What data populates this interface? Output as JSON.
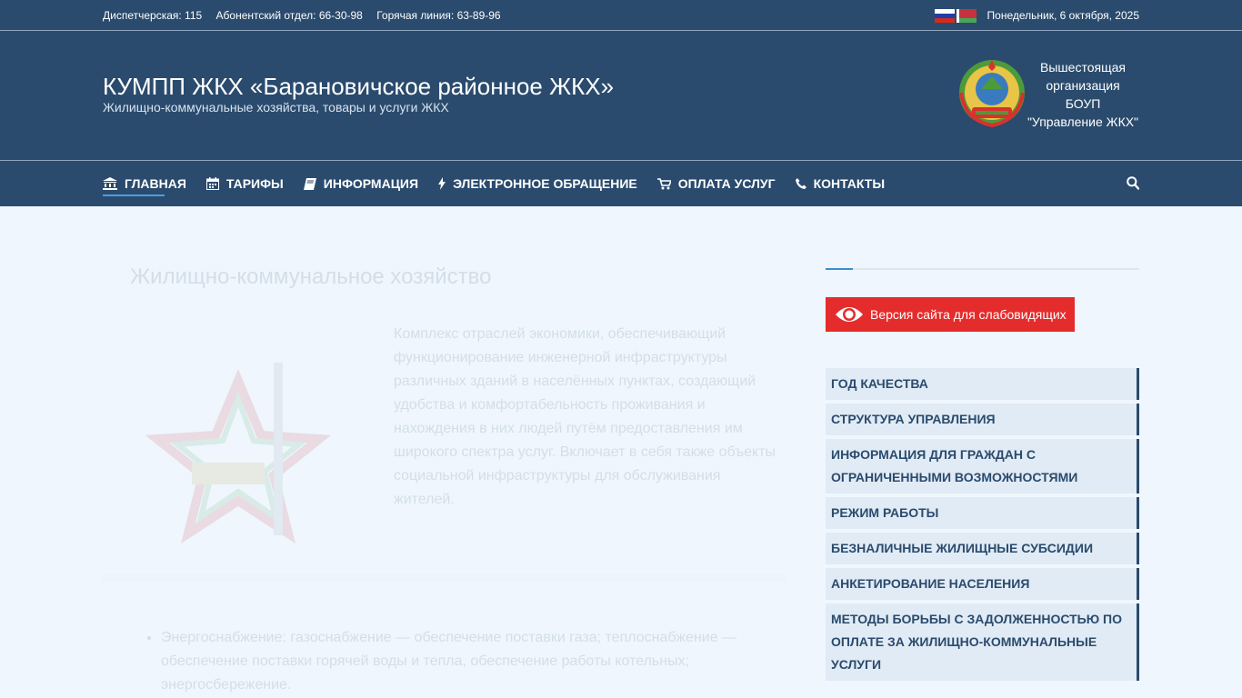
{
  "topbar": {
    "dispatch": "Диспетчерская: 115",
    "subscriber": "Абонентский отдел: 66-30-98",
    "hotline": "Горячая линия: 63-89-96",
    "date": "Понедельник, 6 октября, 2025"
  },
  "header": {
    "title": "КУМПП ЖКХ «Барановичское районное ЖКХ»",
    "subtitle": "Жилищно-коммунальные хозяйства, товары и услуги ЖКХ",
    "superior_line1": "Вышестоящая",
    "superior_line2": "организация",
    "superior_line3": "БОУП",
    "superior_line4": "\"Управление ЖКХ\""
  },
  "nav": {
    "items": [
      {
        "label": "ГЛАВНАЯ",
        "icon": "bank-icon"
      },
      {
        "label": "ТАРИФЫ",
        "icon": "calendar-icon"
      },
      {
        "label": "ИНФОРМАЦИЯ",
        "icon": "book-icon"
      },
      {
        "label": "ЭЛЕКТРОННОЕ ОБРАЩЕНИЕ",
        "icon": "bolt-icon"
      },
      {
        "label": "ОПЛАТА УСЛУГ",
        "icon": "cart-icon"
      },
      {
        "label": "КОНТАКТЫ",
        "icon": "phone-icon"
      }
    ]
  },
  "article": {
    "title": "Жилищно-коммунальное хозяйство",
    "text": "Комплекс отраслей экономики, обеспечивающий функционирование инженерной инфраструктуры различных зданий в населённых пунктах, создающий удобства и комфортабельность проживания и нахождения в них людей путём предоставления им широкого спектра услуг. Включает в себя также объекты социальной инфраструктуры для обслуживания жителей.",
    "list": [
      "Энергоснабжение: газоснабжение — обеспечение поставки газа; теплоснабжение — обеспечение поставки горячей воды и тепла, обеспечение работы котельных; энергосбережение."
    ]
  },
  "sidebar": {
    "impaired_label": "Версия сайта для слабовидящих",
    "menu": [
      "ГОД КАЧЕСТВА",
      "СТРУКТУРА УПРАВЛЕНИЯ",
      "ИНФОРМАЦИЯ ДЛЯ ГРАЖДАН С ОГРАНИЧЕННЫМИ ВОЗМОЖНОСТЯМИ",
      "РЕЖИМ РАБОТЫ",
      "БЕЗНАЛИЧНЫЕ ЖИЛИЩНЫЕ СУБСИДИИ",
      "АНКЕТИРОВАНИЕ НАСЕЛЕНИЯ",
      "МЕТОДЫ БОРЬБЫ С ЗАДОЛЖЕННОСТЬЮ ПО ОПЛАТЕ ЗА ЖИЛИЩНО-КОММУНАЛЬНЫЕ УСЛУГИ"
    ]
  },
  "colors": {
    "header_bg": "#2a4b6d",
    "page_bg": "#eff6fd",
    "accent_red": "#e52c2c",
    "accent_blue": "#4a9fe0"
  }
}
